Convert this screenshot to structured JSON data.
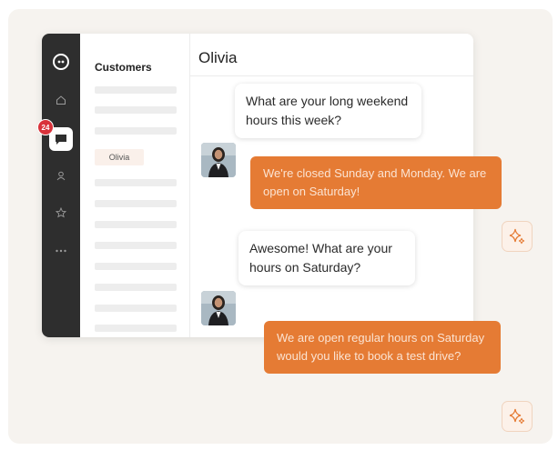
{
  "sidebar": {
    "badge_count": "24",
    "icons": [
      "chat-logo-icon",
      "home-icon",
      "messages-icon",
      "person-icon",
      "star-icon",
      "more-icon"
    ]
  },
  "customers": {
    "title": "Customers",
    "selected_customer": "Olivia"
  },
  "chat": {
    "title": "Olivia",
    "messages": [
      {
        "from": "customer",
        "text": "What are your long weekend hours this week?"
      },
      {
        "from": "business",
        "text": "We're closed Sunday and Monday. We are open on Saturday!"
      },
      {
        "from": "customer",
        "text": "Awesome! What are your hours on Saturday?"
      },
      {
        "from": "business",
        "text": "We are open regular hours on Saturday would you like to book a test drive?"
      }
    ]
  },
  "colors": {
    "accent": "#e57b34",
    "rail": "#2e2e2e",
    "badge": "#d9323a",
    "background": "#f6f3ef"
  }
}
